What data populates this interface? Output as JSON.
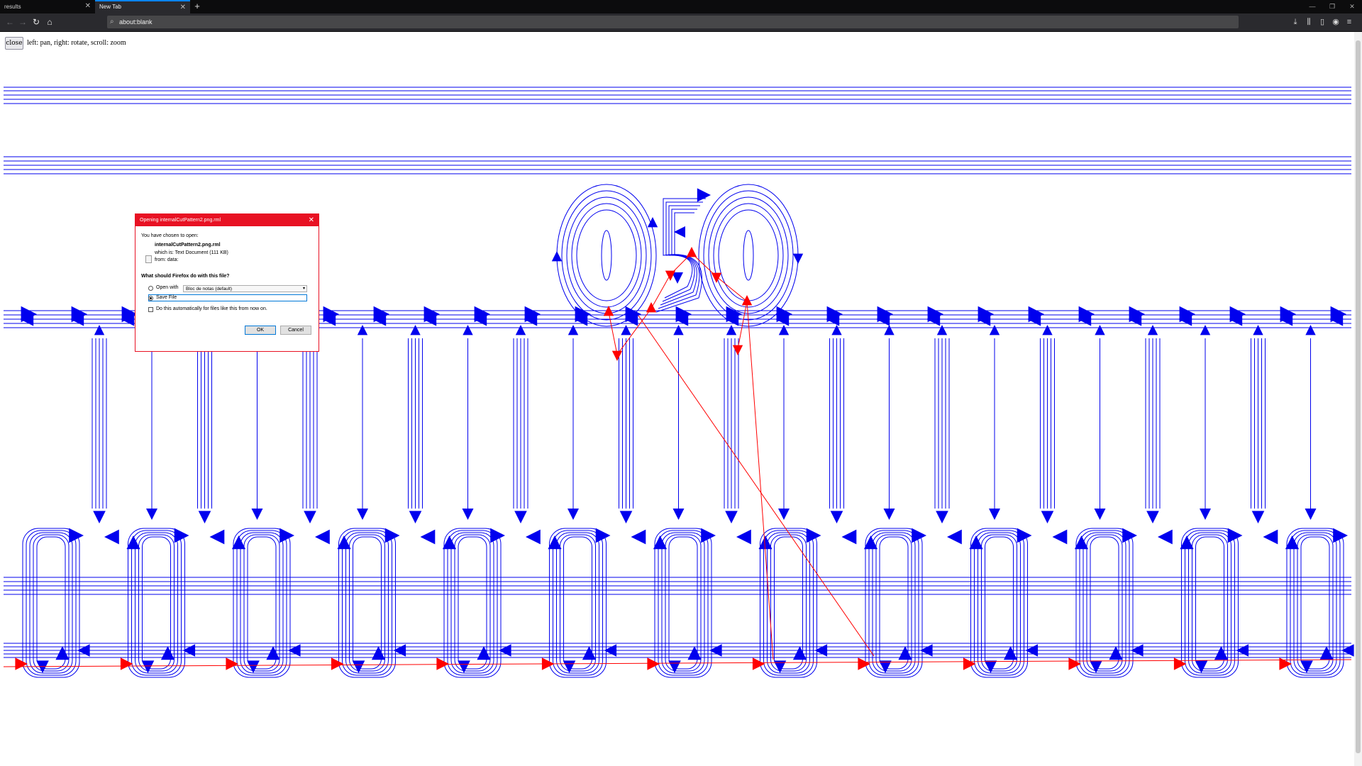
{
  "browser": {
    "tabs": [
      {
        "label": "results",
        "active": false
      },
      {
        "label": "New Tab",
        "active": true
      }
    ],
    "new_tab_symbol": "+",
    "url": "about:blank",
    "window_controls": [
      "—",
      "❐",
      "✕"
    ],
    "nav_icons": [
      "back-icon",
      "forward-icon",
      "reload-icon",
      "home-icon"
    ],
    "toolbar_icons": [
      "download-icon",
      "library-icon",
      "sidebar-icon",
      "account-icon",
      "menu-icon"
    ]
  },
  "page": {
    "close_label": "close",
    "hint": "left: pan, right: rotate, scroll: zoom",
    "colors": {
      "path": "#0000ee",
      "cut": "#ff0000",
      "background": "#ffffff"
    }
  },
  "dialog": {
    "title": "Opening internalCutPattern2.png.rml",
    "chosen_text": "You have chosen to open:",
    "filename": "internalCutPattern2.png.rml",
    "which_is": "which is: Text Document (111 KB)",
    "from": "from: data:",
    "question": "What should Firefox do with this file?",
    "open_with_label": "Open with",
    "open_with_app": "Bloc de notas (default)",
    "save_file_label": "Save File",
    "auto_label": "Do this automatically for files like this from now on.",
    "ok_label": "OK",
    "cancel_label": "Cancel",
    "accent": "#e81123"
  }
}
